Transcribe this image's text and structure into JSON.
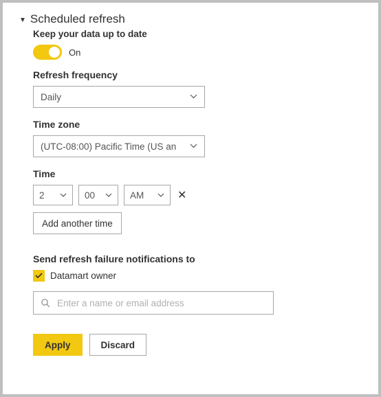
{
  "section": {
    "title": "Scheduled refresh"
  },
  "keepData": {
    "label": "Keep your data up to date",
    "toggleState": "On"
  },
  "frequency": {
    "label": "Refresh frequency",
    "value": "Daily"
  },
  "timezone": {
    "label": "Time zone",
    "value": "(UTC-08:00) Pacific Time (US an"
  },
  "time": {
    "label": "Time",
    "hour": "2",
    "minute": "00",
    "ampm": "AM",
    "addAnother": "Add another time"
  },
  "notifications": {
    "label": "Send refresh failure notifications to",
    "ownerLabel": "Datamart owner",
    "placeholder": "Enter a name or email address"
  },
  "buttons": {
    "apply": "Apply",
    "discard": "Discard"
  }
}
